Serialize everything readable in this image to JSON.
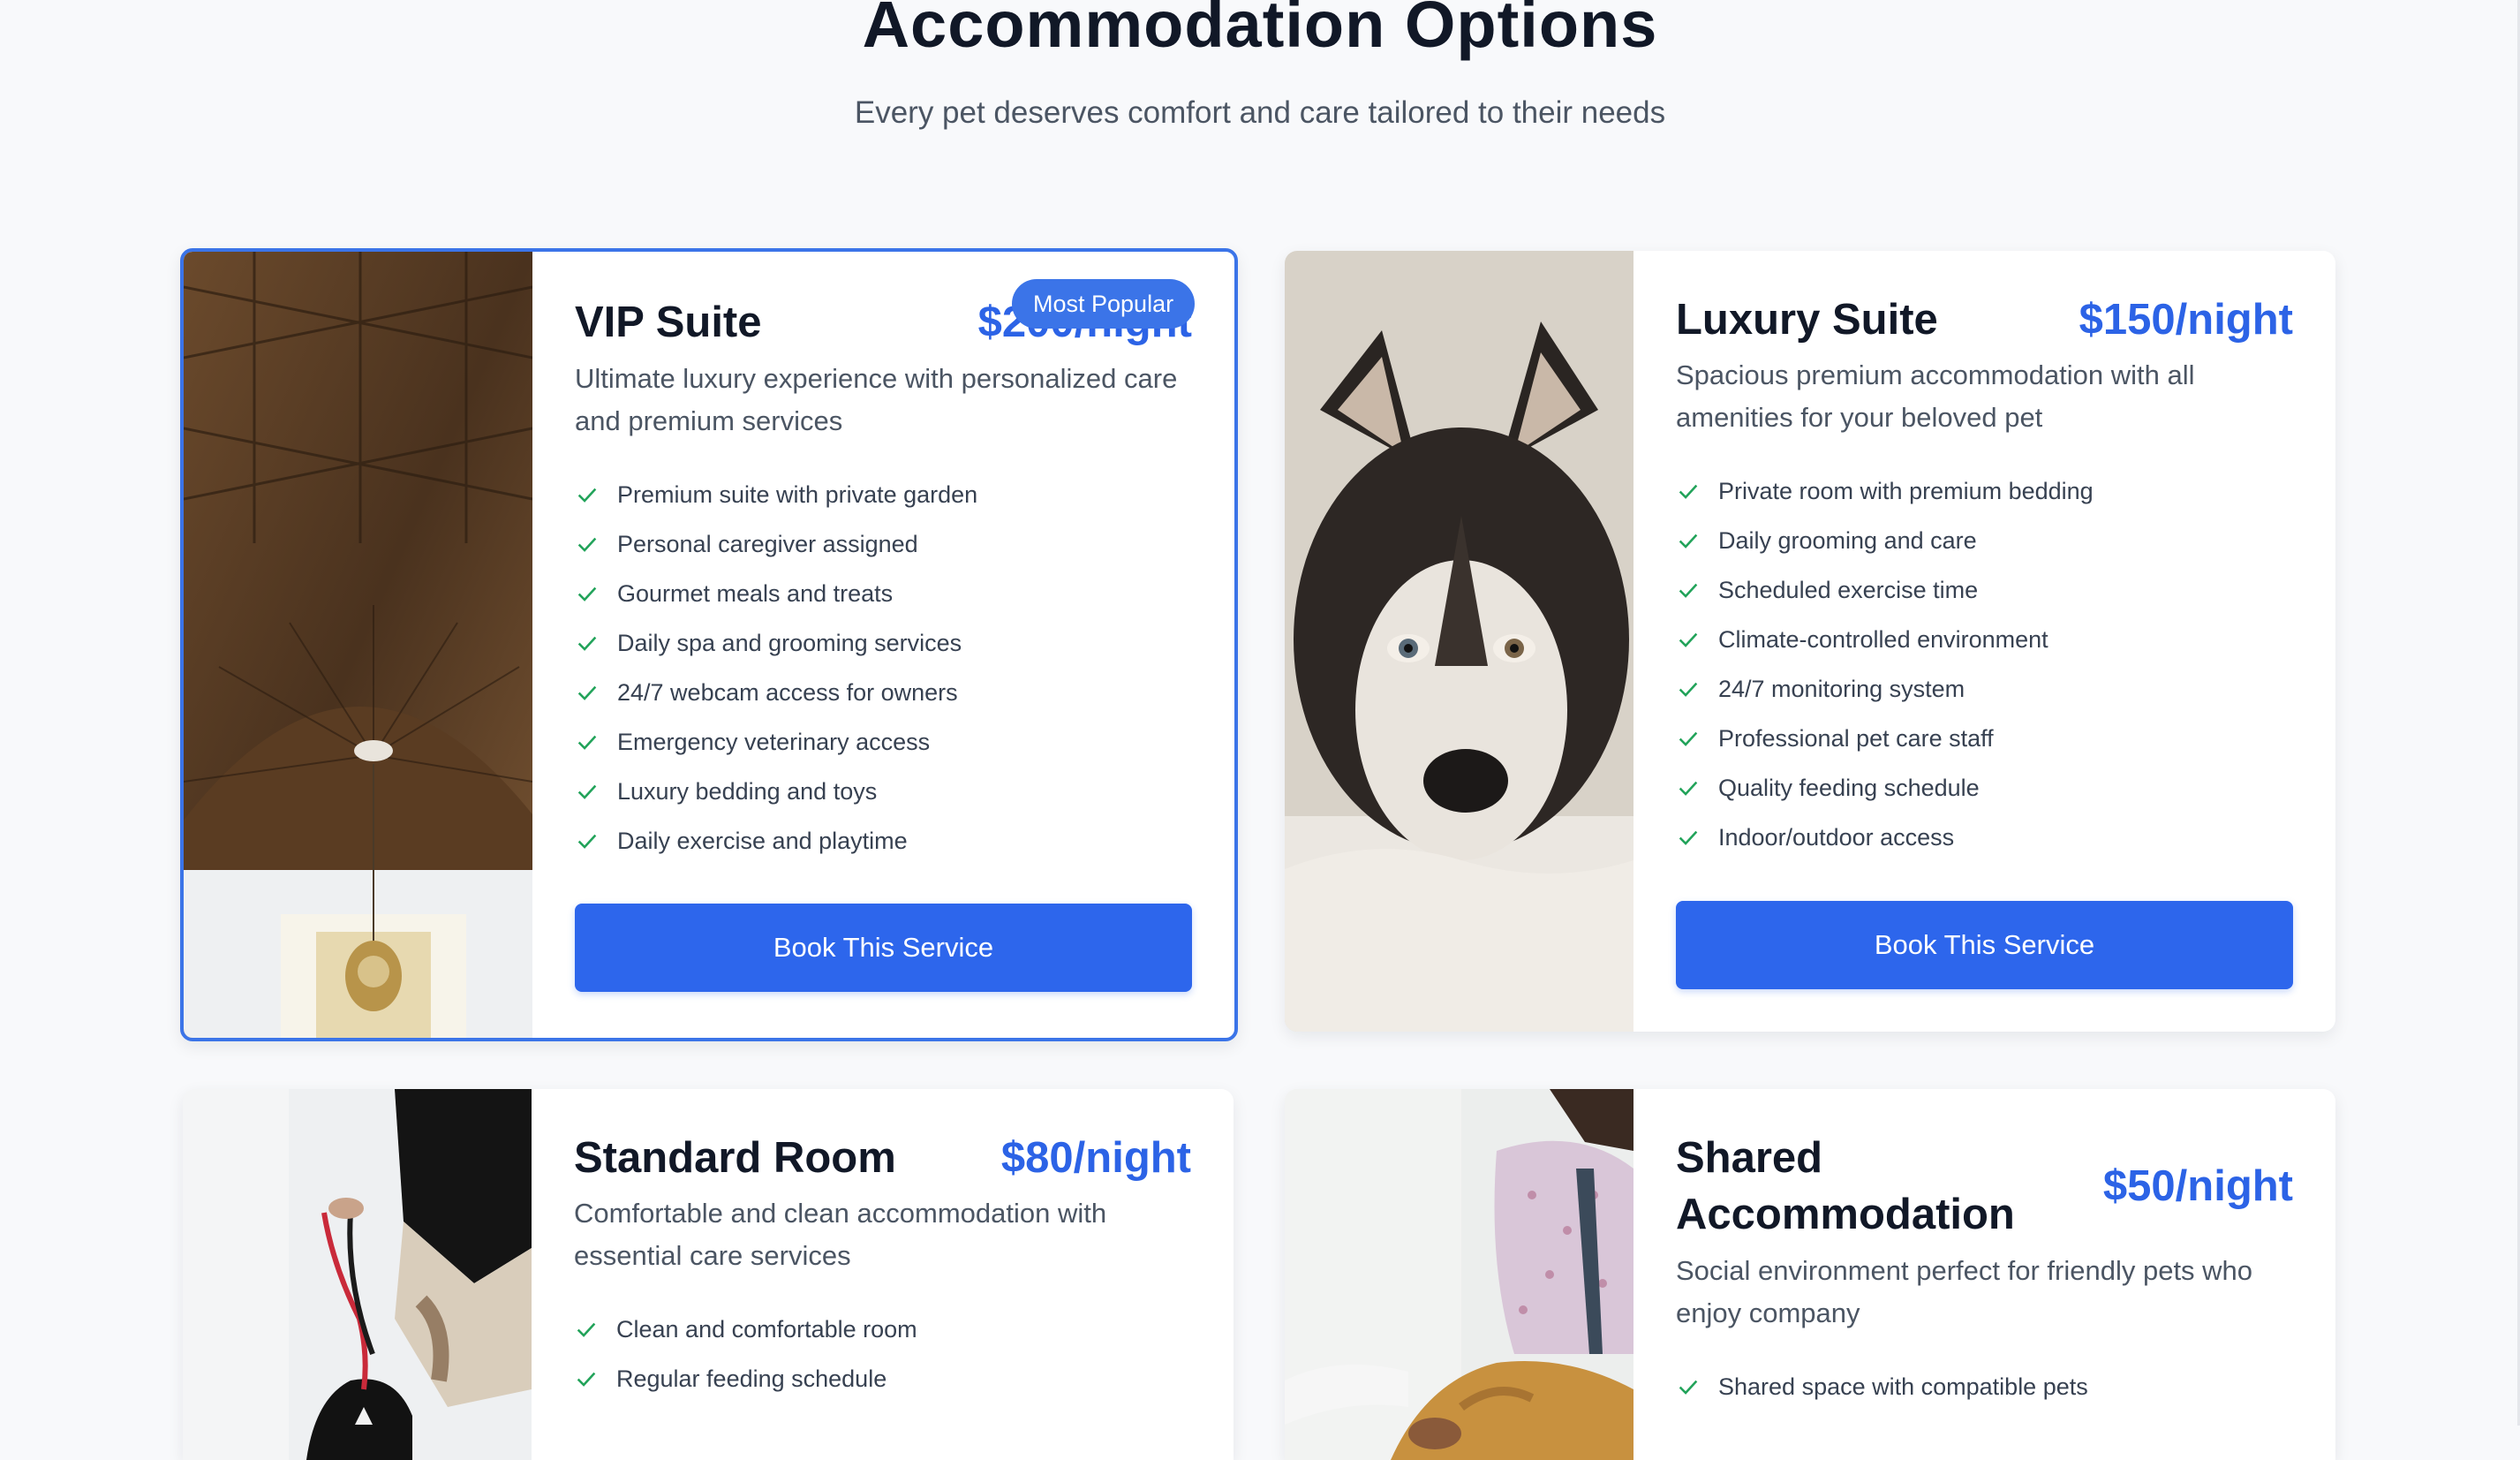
{
  "header": {
    "title": "Accommodation Options",
    "subtitle": "Every pet deserves comfort and care tailored to their needs"
  },
  "colors": {
    "accent": "#2d66ec",
    "price": "#2c63e6",
    "check": "#22a35a",
    "popular_border": "#3b74e8"
  },
  "cards": [
    {
      "title": "VIP Suite",
      "price": "$200/night",
      "badge": "Most Popular",
      "description": "Ultimate luxury experience with personalized care and premium services",
      "features": [
        "Premium suite with private garden",
        "Personal caregiver assigned",
        "Gourmet meals and treats",
        "Daily spa and grooming services",
        "24/7 webcam access for owners",
        "Emergency veterinary access",
        "Luxury bedding and toys",
        "Daily exercise and playtime"
      ],
      "button": "Book This Service"
    },
    {
      "title": "Luxury Suite",
      "price": "$150/night",
      "description": "Spacious premium accommodation with all amenities for your beloved pet",
      "features": [
        "Private room with premium bedding",
        "Daily grooming and care",
        "Scheduled exercise time",
        "Climate-controlled environment",
        "24/7 monitoring system",
        "Professional pet care staff",
        "Quality feeding schedule",
        "Indoor/outdoor access"
      ],
      "button": "Book This Service"
    },
    {
      "title": "Standard Room",
      "price": "$80/night",
      "description": "Comfortable and clean accommodation with essential care services",
      "features": [
        "Clean and comfortable room",
        "Regular feeding schedule"
      ]
    },
    {
      "title": "Shared Accommodation",
      "price": "$50/night",
      "description": "Social environment perfect for friendly pets who enjoy company",
      "features": [
        "Shared space with compatible pets"
      ]
    }
  ]
}
